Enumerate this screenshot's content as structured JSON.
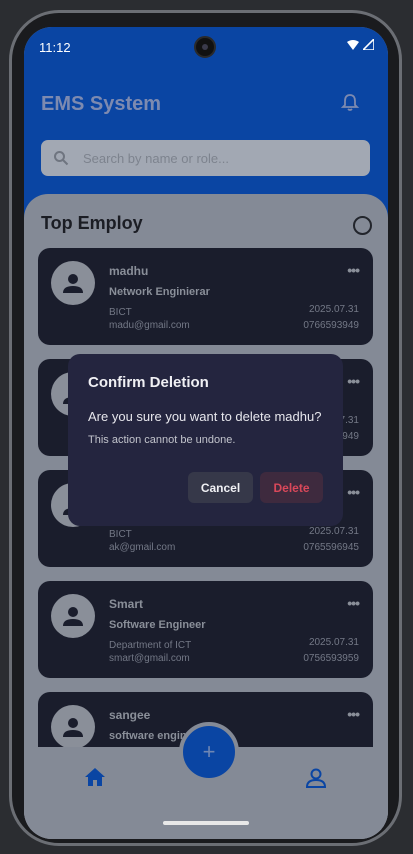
{
  "status_bar": {
    "time": "11:12"
  },
  "header": {
    "title": "EMS System"
  },
  "search": {
    "placeholder": "Search by name or role..."
  },
  "section": {
    "title": "Top Employ"
  },
  "employees": [
    {
      "name": "madhu",
      "role": "Network Enginierar",
      "department": "BICT",
      "email": "madu@gmail.com",
      "date": "2025.07.31",
      "phone": "0766593949"
    },
    {
      "name": "",
      "role": "",
      "department": "",
      "email": "",
      "date": "2025.07.31",
      "phone": "0766593949"
    },
    {
      "name": "",
      "role": "",
      "department": "BICT",
      "email": "ak@gmail.com",
      "date": "2025.07.31",
      "phone": "0765596945"
    },
    {
      "name": "Smart",
      "role": "Software Engineer",
      "department": "Department of ICT",
      "email": "smart@gmail.com",
      "date": "2025.07.31",
      "phone": "0756593959"
    },
    {
      "name": "sangee",
      "role": "software engin",
      "department": "",
      "email": "",
      "date": "",
      "phone": ""
    }
  ],
  "dialog": {
    "title": "Confirm Deletion",
    "message": "Are you sure you want to delete madhu?",
    "sub": "This action cannot be undone.",
    "cancel": "Cancel",
    "delete": "Delete"
  },
  "fab": {
    "icon": "+"
  },
  "colors": {
    "primary": "#0a45a3",
    "danger": "#d9485a",
    "card": "#1a1d2c",
    "dialog": "#24253f"
  }
}
